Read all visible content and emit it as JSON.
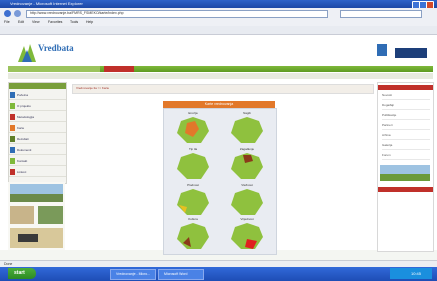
{
  "window": {
    "title": "Vrednovanje - Microsoft Internet Explorer",
    "address": "http://www.vrednovanje.ba/FMRS_FSMEKO/karte/index.php",
    "menu": [
      "File",
      "Edit",
      "View",
      "Favorites",
      "Tools",
      "Help"
    ]
  },
  "site": {
    "logo": "Vredbata",
    "logo_sub": ""
  },
  "breadcrumb": "Vrednovanje tla >> Karte",
  "map_panel": {
    "title": "Karte vrednovanja",
    "maps": [
      {
        "label": "Erozija",
        "accent": "#e2782a"
      },
      {
        "label": "Nagib",
        "accent": "#5e7e28"
      },
      {
        "label": "Tip tla",
        "accent": "#7fb93a"
      },
      {
        "label": "Zagađenje",
        "accent": "#8b3a1a"
      },
      {
        "label": "Plodnost",
        "accent": "#e8c020"
      },
      {
        "label": "Vlažnost",
        "accent": "#7fb93a"
      },
      {
        "label": "Kultura",
        "accent": "#8b3a1a"
      },
      {
        "label": "Vrijednost",
        "accent": "#e02020"
      }
    ]
  },
  "leftnav": {
    "items": [
      {
        "label": "Početna",
        "color": "#2f6db5"
      },
      {
        "label": "O projektu",
        "color": "#7fb93a"
      },
      {
        "label": "Metodologija",
        "color": "#c0302a"
      },
      {
        "label": "Karte",
        "color": "#e2782a"
      },
      {
        "label": "Rezultati",
        "color": "#5e7e28"
      },
      {
        "label": "Dokumenti",
        "color": "#2f6db5"
      },
      {
        "label": "Kontakt",
        "color": "#7fb93a"
      },
      {
        "label": "Linkovi",
        "color": "#c0302a"
      }
    ]
  },
  "rightcol": {
    "items": [
      "Novosti",
      "Događaji",
      "Publikacije",
      "Partneri",
      "Arhiva",
      "Galerija",
      "Forum"
    ]
  },
  "statusbar": "Done",
  "taskbar": {
    "start": "start",
    "tasks": [
      "Vrednovanje - Micro...",
      "Microsoft Word"
    ],
    "clock": "10:45"
  }
}
